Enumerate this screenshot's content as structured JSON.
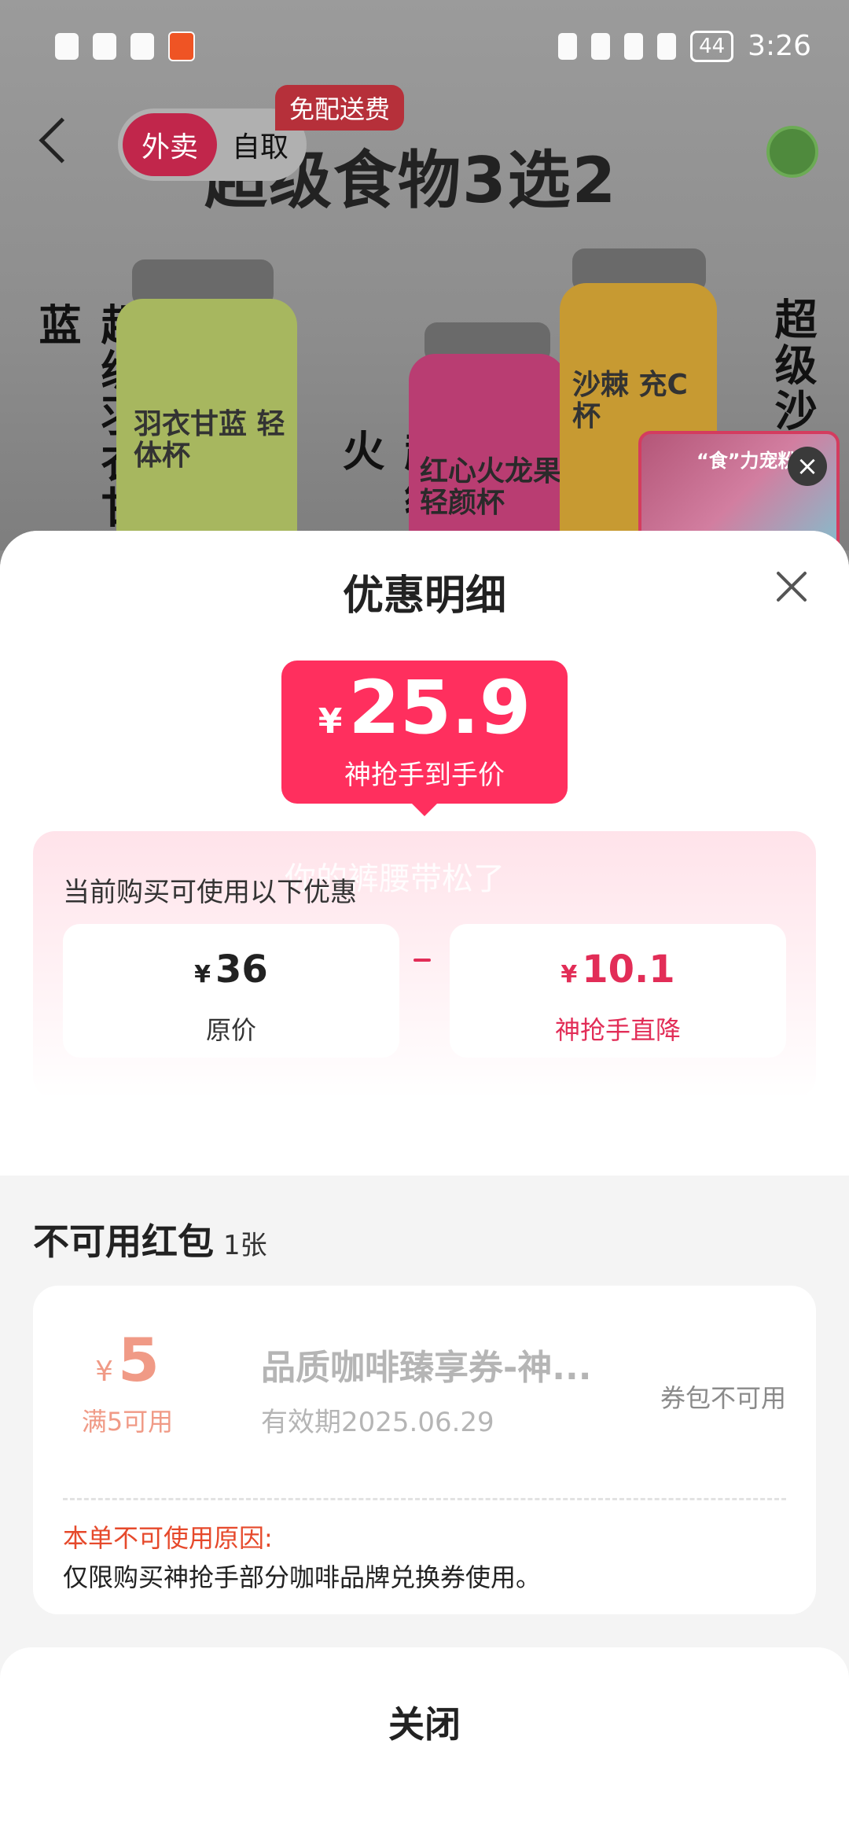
{
  "status_bar": {
    "time": "3:26",
    "battery": "44"
  },
  "background_page": {
    "delivery_tab": "外卖",
    "pickup_tab": "自取",
    "free_delivery_badge": "免配送费",
    "banner_title": "超级食物3选2",
    "side_text_left": "超级羽衣甘蓝",
    "side_text_middle": "超级火",
    "side_text_right": "超级沙",
    "bottle_labels": [
      "羽衣甘蓝 轻体杯",
      "红心火龙果 轻颜杯",
      "沙棘 充C杯"
    ],
    "mini_promo_title": "“食”力宠粉"
  },
  "sheet": {
    "title": "优惠明细",
    "final_price": {
      "currency": "¥",
      "value": "25.9",
      "label": "神抢手到手价"
    },
    "watermark": "你的裤腰带松了",
    "discount_caption": "当前购买可使用以下优惠",
    "original_price": {
      "currency": "¥",
      "value": "36",
      "label": "原价"
    },
    "operator": "-",
    "direct_discount": {
      "currency": "¥",
      "value": "10.1",
      "label": "神抢手直降"
    },
    "unusable_section": {
      "title": "不可用红包",
      "count": "1张"
    },
    "coupon": {
      "currency": "¥",
      "amount": "5",
      "condition": "满5可用",
      "name": "品质咖啡臻享券-神...",
      "validity": "有效期2025.06.29",
      "status": "券包不可用",
      "reason_title": "本单不可使用原因:",
      "reason_text": "仅限购买神抢手部分咖啡品牌兑换券使用。"
    },
    "close_button": "关闭"
  },
  "colors": {
    "accent": "#ff2f5e",
    "discount_red": "#e22d57",
    "coupon_orange": "#f09a86",
    "reason_red": "#e6492b"
  }
}
